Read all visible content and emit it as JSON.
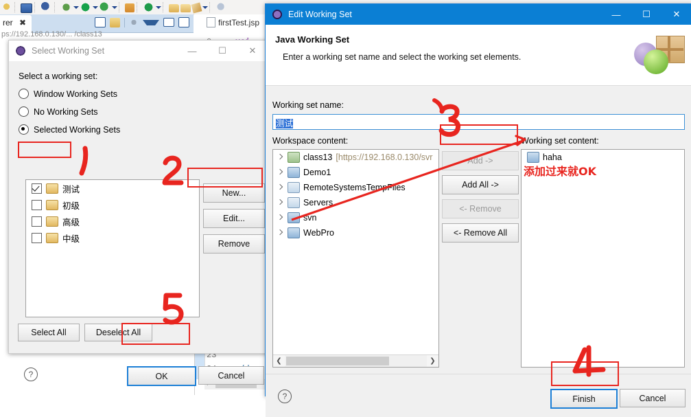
{
  "background": {
    "view_tab_label": "rer",
    "editor_tab_label": "firstTest.jsp",
    "ghost_url": "ps://192.168.0.130/...    /class13",
    "code_lines": [
      "23",
      "24"
    ],
    "code_snippet": "</d",
    "code_snippet2": "xsi",
    "code_line_num": "2",
    "toolbar_icons": [
      "debug-icon",
      "console-icon",
      "inspect-icon",
      "bug-icon",
      "run-icon",
      "run-as-icon",
      "coverage-icon",
      "external-tools-icon",
      "search-icon",
      "open-type-icon",
      "open-resource-icon",
      "next-annotation-icon"
    ],
    "view_icons": [
      "collapse-all-icon",
      "link-editor-icon",
      "focus-icon",
      "filter-icon",
      "minimize-icon",
      "maximize-icon"
    ]
  },
  "select_dialog": {
    "title": "Select Working Set",
    "icon": "eclipse-icon",
    "window_buttons": [
      "minimize",
      "maximize",
      "close"
    ],
    "prompt": "Select a working set:",
    "radios": [
      {
        "label": "Window Working Sets",
        "selected": false
      },
      {
        "label": "No Working Sets",
        "selected": false
      },
      {
        "label": "Selected Working Sets",
        "selected": true
      }
    ],
    "working_sets": [
      {
        "label": "测试",
        "checked": true
      },
      {
        "label": "初级",
        "checked": false
      },
      {
        "label": "高级",
        "checked": false
      },
      {
        "label": "中级",
        "checked": false
      }
    ],
    "side_buttons": [
      {
        "label": "New...",
        "enabled": true
      },
      {
        "label": "Edit...",
        "enabled": true
      },
      {
        "label": "Remove",
        "enabled": true
      }
    ],
    "select_all": "Select All",
    "deselect_all": "Deselect All",
    "help_icon": "question-mark-icon",
    "ok": "OK",
    "cancel": "Cancel"
  },
  "edit_dialog": {
    "title": "Edit Working Set",
    "icon": "eclipse-icon",
    "window_buttons": [
      "minimize",
      "maximize",
      "close"
    ],
    "header_title": "Java Working Set",
    "header_subtitle": "Enter a working set name and select the working set elements.",
    "header_image": "balloons-gift-icon",
    "name_label": "Working set name:",
    "name_value": "测试",
    "workspace_label": "Workspace content:",
    "workspace_items": [
      {
        "label": "class13",
        "suffix": "[https://192.168.0.130/svr",
        "icon": "java-project-svn-icon"
      },
      {
        "label": "Demo1",
        "suffix": "",
        "icon": "web-project-icon"
      },
      {
        "label": "RemoteSystemsTempFiles",
        "suffix": "",
        "icon": "folder-project-icon"
      },
      {
        "label": "Servers",
        "suffix": "",
        "icon": "folder-project-icon"
      },
      {
        "label": "svn",
        "suffix": "",
        "icon": "web-project-warning-icon"
      },
      {
        "label": "WebPro",
        "suffix": "",
        "icon": "web-project-icon"
      }
    ],
    "transfer_buttons": [
      {
        "label": "Add ->",
        "enabled": false
      },
      {
        "label": "Add All ->",
        "enabled": true
      },
      {
        "label": "<- Remove",
        "enabled": false
      },
      {
        "label": "<- Remove All",
        "enabled": true
      }
    ],
    "content_label": "Working set content:",
    "content_items": [
      {
        "label": "haha",
        "icon": "web-project-icon"
      }
    ],
    "help_icon": "question-mark-icon",
    "finish": "Finish",
    "cancel": "Cancel"
  },
  "annotations": {
    "color": "#e8251f",
    "marks": [
      {
        "id": "1",
        "text": "1",
        "target": "checked-working-set"
      },
      {
        "id": "2",
        "text": "2",
        "target": "edit-button"
      },
      {
        "id": "3",
        "text": "3",
        "target": "add-button"
      },
      {
        "id": "4",
        "text": "4",
        "target": "finish-button"
      },
      {
        "id": "5",
        "text": "5",
        "target": "ok-button"
      }
    ],
    "note": "添加过来就OK"
  }
}
